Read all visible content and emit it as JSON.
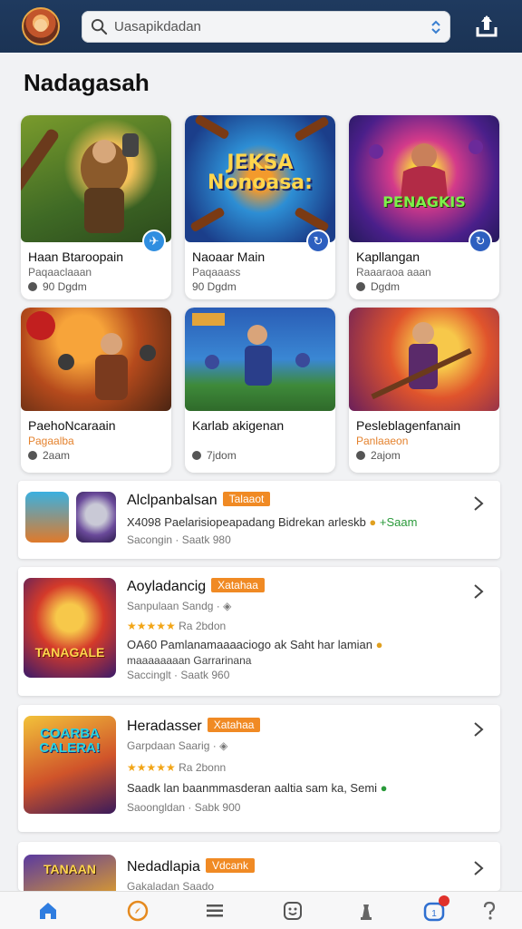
{
  "search": {
    "placeholder": "Uasapikdadan"
  },
  "section_title": "Nadagasah",
  "grid": [
    {
      "name": "Haan Btaroopain",
      "sub": "Paqaaclaaan",
      "meta": "90 Dgdm",
      "art_text": "",
      "badge": "plane-icon"
    },
    {
      "name": "Naoaar Main",
      "sub": "Paqaaass",
      "meta": "90 Dgdm",
      "art_text": "JEKSA Nonoasa:",
      "badge": "refresh-icon"
    },
    {
      "name": "Kapllangan",
      "sub": "Raaaraoa aaan",
      "meta": "Dgdm",
      "art_text": "PENAGKIS",
      "badge": "refresh-icon"
    },
    {
      "name": "PaehoNcaraain",
      "sub": "Pagaalba",
      "meta": "2aam",
      "art_text": "",
      "badge": ""
    },
    {
      "name": "Karlab akigenan",
      "sub": "",
      "meta": "7jdom",
      "art_text": "",
      "badge": ""
    },
    {
      "name": "Pesleblagenfanain",
      "sub": "Panlaaeon",
      "meta": "2ajom",
      "art_text": "",
      "badge": ""
    }
  ],
  "list": [
    {
      "title": "Alclpanbalsan",
      "tag": "Talaaot",
      "line1": "X4098 Paelarisiopeapadang Bidrekan arleskb",
      "line1_suffix": "+Saam",
      "small": "Sacongin · Saatk 980"
    },
    {
      "title": "Aoyladancig",
      "tag": "Xatahaa",
      "sub": "Sanpulaan Sandg ·",
      "rating": "★★★★★",
      "rating_text": "Ra 2bdon",
      "line1": "OA60 Pamlanamaaaaciogo ak Saht har lamian",
      "line2": "maaaaaaaan Garrarinana",
      "small": "Saccinglt · Saatk 960",
      "thumb_text": "TANAGALE"
    },
    {
      "title": "Heradasser",
      "tag": "Xatahaa",
      "sub": "Garpdaan Saarig ·",
      "rating": "★★★★★",
      "rating_text": "Ra 2bonn",
      "line1": "Saadk lan baanmmasderan aaltia sam ka, Semi",
      "small": "Saoongldan · Sabk 900",
      "thumb_text": "COARBA CALERA!"
    },
    {
      "title": "Nedadlapia",
      "tag": "Vdcank",
      "sub": "Gakaladan Saado",
      "thumb_text": "TANAAN"
    }
  ],
  "colors": {
    "topbar": "#1f3a5f",
    "accent": "#f08a24",
    "badge": "#2f8ee0"
  },
  "bottom_nav": [
    "home-icon",
    "compass-icon",
    "menu-icon",
    "smiley-icon",
    "chess-piece-icon",
    "notification-icon",
    "question-icon"
  ]
}
